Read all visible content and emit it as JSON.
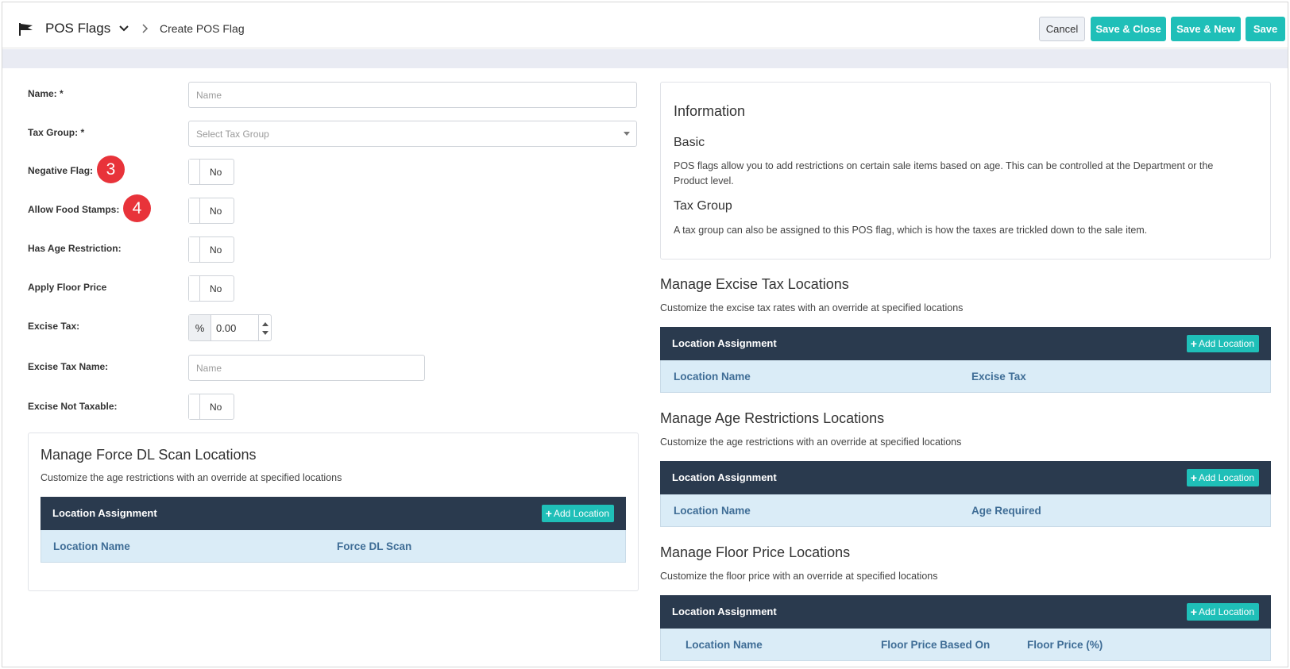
{
  "header": {
    "module": "POS Flags",
    "page": "Create POS Flag",
    "cancel": "Cancel",
    "save_close": "Save & Close",
    "save_new": "Save & New",
    "save": "Save"
  },
  "form": {
    "name_label": "Name: *",
    "name_placeholder": "Name",
    "tax_group_label": "Tax Group: *",
    "tax_group_placeholder": "Select Tax Group",
    "negative_flag_label": "Negative Flag:",
    "negative_flag_value": "No",
    "food_stamps_label": "Allow Food Stamps:",
    "food_stamps_value": "No",
    "age_restriction_label": "Has Age Restriction:",
    "age_restriction_value": "No",
    "floor_price_label": "Apply Floor Price",
    "floor_price_value": "No",
    "excise_tax_label": "Excise Tax:",
    "excise_tax_addon": "%",
    "excise_tax_value": "0.00",
    "excise_name_label": "Excise Tax Name:",
    "excise_name_placeholder": "Name",
    "excise_not_taxable_label": "Excise Not Taxable:",
    "excise_not_taxable_value": "No"
  },
  "badges": {
    "b3": "3",
    "b4": "4"
  },
  "force_dl": {
    "title": "Manage Force DL Scan Locations",
    "subtitle": "Customize the age restrictions with an override at specified locations",
    "header": "Location Assignment",
    "add": "Add Location",
    "col1": "Location Name",
    "col2": "Force DL Scan"
  },
  "info": {
    "title": "Information",
    "basic_h": "Basic",
    "basic_p": "POS flags allow you to add restrictions on certain sale items based on age. This can be controlled at the Department or the Product level.",
    "tax_h": "Tax Group",
    "tax_p": "A tax group can also be assigned to this POS flag, which is how the taxes are trickled down to the sale item."
  },
  "excise": {
    "title": "Manage Excise Tax Locations",
    "subtitle": "Customize the excise tax rates with an override at specified locations",
    "header": "Location Assignment",
    "add": "Add Location",
    "col1": "Location Name",
    "col2": "Excise Tax"
  },
  "age": {
    "title": "Manage Age Restrictions Locations",
    "subtitle": "Customize the age restrictions with an override at specified locations",
    "header": "Location Assignment",
    "add": "Add Location",
    "col1": "Location Name",
    "col2": "Age Required"
  },
  "floor": {
    "title": "Manage Floor Price Locations",
    "subtitle": "Customize the floor price with an override at specified locations",
    "header": "Location Assignment",
    "add": "Add Location",
    "col1": "Location Name",
    "col2": "Floor Price Based On",
    "col3": "Floor Price (%)"
  },
  "colors": {
    "accent": "#1fbfb8",
    "header_dark": "#2a3a4e",
    "column_bg": "#daecf7",
    "badge": "#e8333a"
  }
}
